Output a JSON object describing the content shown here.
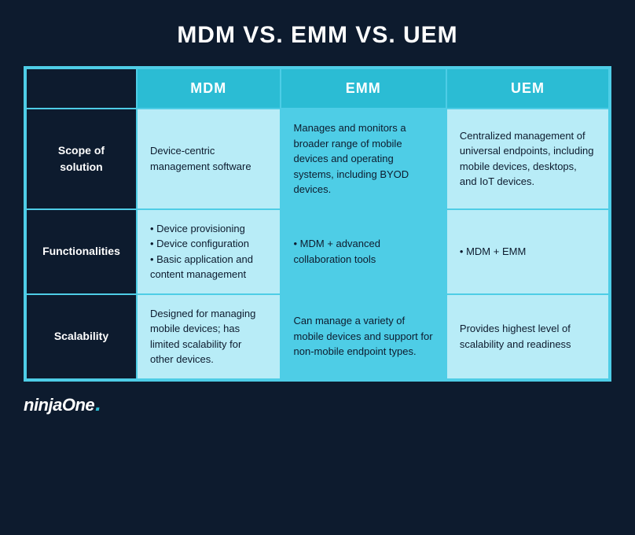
{
  "title": "MDM VS. EMM VS. UEM",
  "table": {
    "headers": [
      "",
      "MDM",
      "EMM",
      "UEM"
    ],
    "rows": [
      {
        "label": "Scope of solution",
        "mdm": "Device-centric management software",
        "emm": "Manages and monitors a broader range of mobile devices and operating systems, including BYOD devices.",
        "uem": "Centralized management of universal endpoints, including mobile devices, desktops, and IoT devices."
      },
      {
        "label": "Functionalities",
        "mdm": "• Device provisioning\n• Device configuration\n• Basic application and content management",
        "emm": "• MDM + advanced collaboration tools",
        "uem": "• MDM + EMM"
      },
      {
        "label": "Scalability",
        "mdm": "Designed for managing mobile devices; has limited scalability for other devices.",
        "emm": "Can manage a variety of mobile devices and support for non-mobile endpoint types.",
        "uem": "Provides highest level of scalability and readiness"
      }
    ]
  },
  "logo": {
    "text": "ninjaOne",
    "dot": "."
  }
}
